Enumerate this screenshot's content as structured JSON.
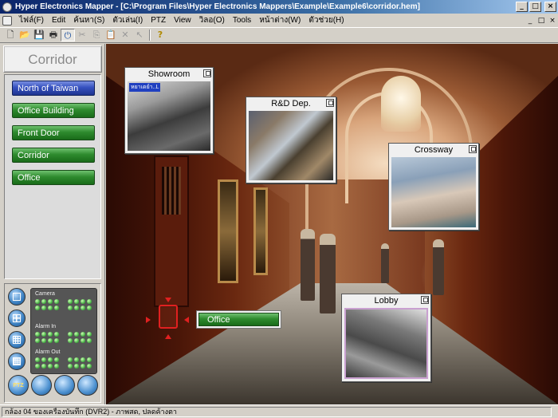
{
  "window": {
    "title": "Hyper Electronics Mapper - [C:\\Program Files\\Hyper Electronics Mappers\\Example\\Example6\\corridor.hem]",
    "buttons": {
      "minimize": "_",
      "maximize": "□",
      "close": "×"
    }
  },
  "menubar": {
    "items": [
      "ไฟล์(F)",
      "Edit",
      "ค้นหา(S)",
      "ตัวเล่น(I)",
      "PTZ",
      "View",
      "วิลอ(O)",
      "Tools",
      "หน้าต่าง(W)",
      "ตัวช่วย(H)"
    ],
    "doc_buttons": [
      "_",
      "□",
      "×"
    ]
  },
  "toolbar": {
    "icons": [
      "new-icon",
      "open-icon",
      "save-icon",
      "print-icon",
      "power-icon",
      "cut-icon",
      "copy-icon",
      "paste-icon",
      "delete-icon",
      "pointer-icon",
      "help-icon"
    ],
    "glyphs": {
      "new": "🗋",
      "open": "📂",
      "save": "💾",
      "print": "🖶",
      "power": "⏻",
      "cut": "✂",
      "copy": "⎘",
      "paste": "📋",
      "delete": "✕",
      "pointer": "↖",
      "help": "?"
    }
  },
  "left_panel": {
    "map_title": "Corridor",
    "nav": [
      {
        "label": "North of Taiwan",
        "active": true
      },
      {
        "label": "Office Building",
        "active": false
      },
      {
        "label": "Front Door",
        "active": false
      },
      {
        "label": "Corridor",
        "active": false
      },
      {
        "label": "Office",
        "active": false
      }
    ],
    "status": {
      "camera_label": "Camera",
      "alarm_in_label": "Alarm In",
      "alarm_out_label": "Alarm Out"
    },
    "bottom_buttons": [
      "PTZ",
      "",
      "",
      ""
    ]
  },
  "map": {
    "cameras": [
      {
        "title": "Showroom",
        "stamp": "หยาเดย์า..L"
      },
      {
        "title": "R&D Dep."
      },
      {
        "title": "Crossway"
      },
      {
        "title": "Lobby"
      }
    ],
    "office_label": "Office"
  },
  "statusbar": {
    "text": "กล้อง 04 ของเครื่องบันทึก (DVR2) - ภาพสด, ปลดค้างตา"
  },
  "colors": {
    "nav_active": "#3550c0",
    "nav_normal": "#2e8b2e",
    "titlebar": "#0a246a",
    "alarm_marker": "#e02020"
  }
}
